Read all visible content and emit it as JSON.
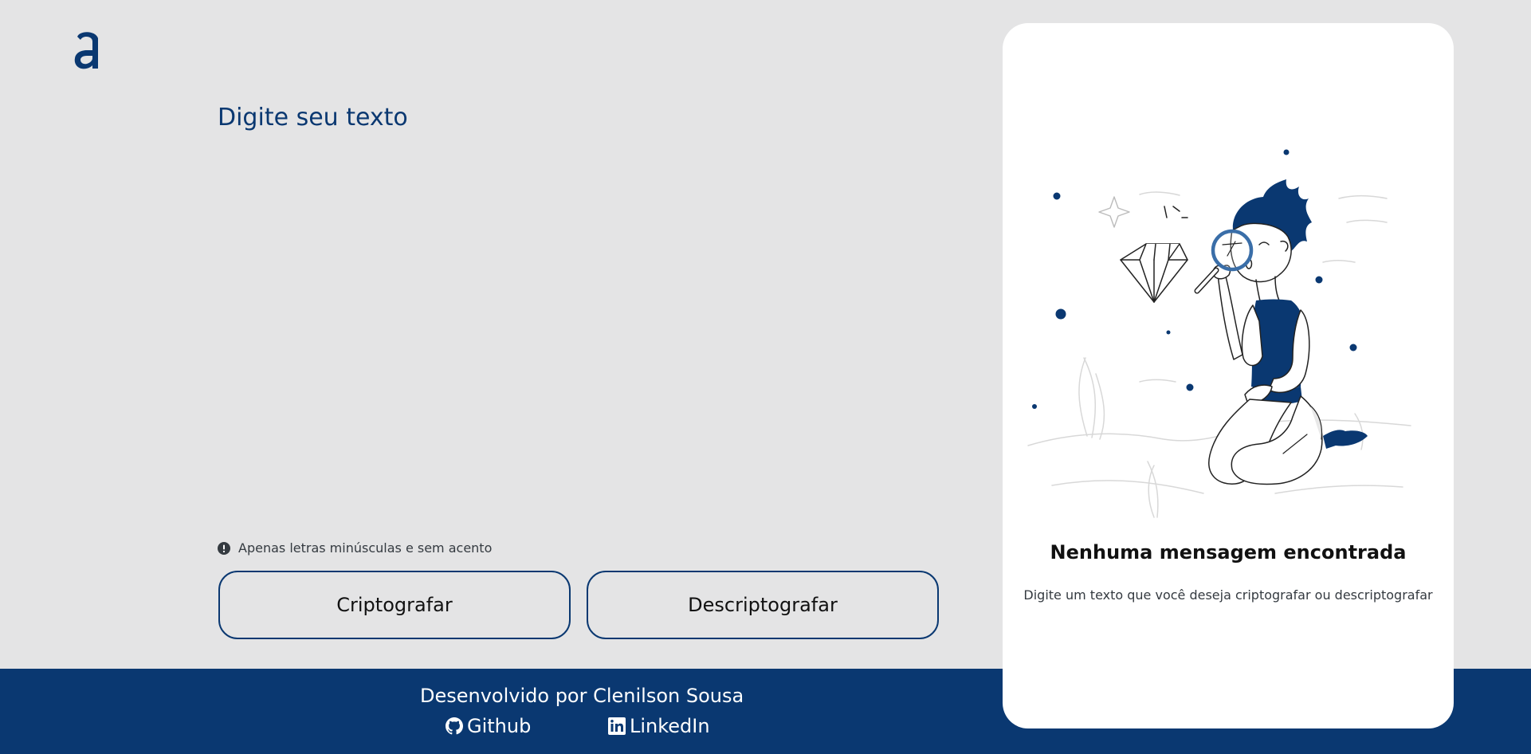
{
  "brand": {
    "logo_icon": "alura-a-logo-icon",
    "primary_color": "#0a3871"
  },
  "input": {
    "placeholder": "Digite seu texto",
    "value": ""
  },
  "hint": {
    "icon": "exclamation-circle-icon",
    "text": "Apenas letras minúsculas e sem acento"
  },
  "actions": {
    "encrypt_label": "Criptografar",
    "decrypt_label": "Descriptografar"
  },
  "output": {
    "illustration": "boy-with-magnifier-and-diamond-illustration",
    "title": "Nenhuma mensagem encontrada",
    "description": "Digite um texto que você deseja criptografar ou descriptografar"
  },
  "footer": {
    "credit": "Desenvolvido por Clenilson Sousa",
    "links": [
      {
        "label": "Github",
        "icon": "github-icon"
      },
      {
        "label": "LinkedIn",
        "icon": "linkedin-icon"
      }
    ]
  }
}
